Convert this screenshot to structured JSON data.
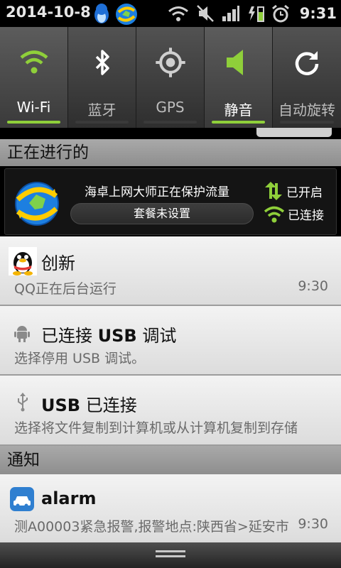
{
  "status_bar": {
    "date": "2014-10-8",
    "time": "9:31",
    "icons": [
      "qq-penguin-icon",
      "globe-sync-icon",
      "wifi-signal-icon",
      "mute-icon",
      "cell-signal-icon",
      "charging-battery-icon",
      "alarm-clock-icon"
    ]
  },
  "quick_settings": [
    {
      "label": "Wi-Fi",
      "icon": "wifi-icon",
      "state": "on"
    },
    {
      "label": "蓝牙",
      "icon": "bluetooth-icon",
      "state": "off"
    },
    {
      "label": "GPS",
      "icon": "gps-icon",
      "state": "off"
    },
    {
      "label": "静音",
      "icon": "silent-speaker-icon",
      "state": "on"
    },
    {
      "label": "自动旋转",
      "icon": "auto-rotate-icon",
      "state": "off"
    }
  ],
  "ongoing": {
    "header": "正在进行的",
    "promo": {
      "title": "海卓上网大师正在保护流量",
      "button": "套餐未设置",
      "status_1": "已开启",
      "status_2": "已连接"
    }
  },
  "notifications": [
    {
      "title": "创新",
      "text": "QQ正在后台运行",
      "time": "9:30",
      "icon": "qq-penguin-icon"
    },
    {
      "title_pre": "已连接 ",
      "title_bold": "USB",
      "title_post": " 调试",
      "text": "选择停用 USB 调试。",
      "icon": "android-debug-icon"
    },
    {
      "title_bold": "USB",
      "title_post": " 已连接",
      "text": "选择将文件复制到计算机或从计算机复制到存储",
      "icon": "usb-icon"
    }
  ],
  "notify_section": {
    "header": "通知",
    "item": {
      "title": "alarm",
      "text": "测A00003紧急报警,报警地点:陕西省>延安市",
      "time": "9:30",
      "icon": "car-alarm-icon"
    }
  },
  "colors": {
    "accent_green": "#8fcf3a",
    "list_bg": "#e6e6e6",
    "header_grey": "#9c9c9c"
  }
}
